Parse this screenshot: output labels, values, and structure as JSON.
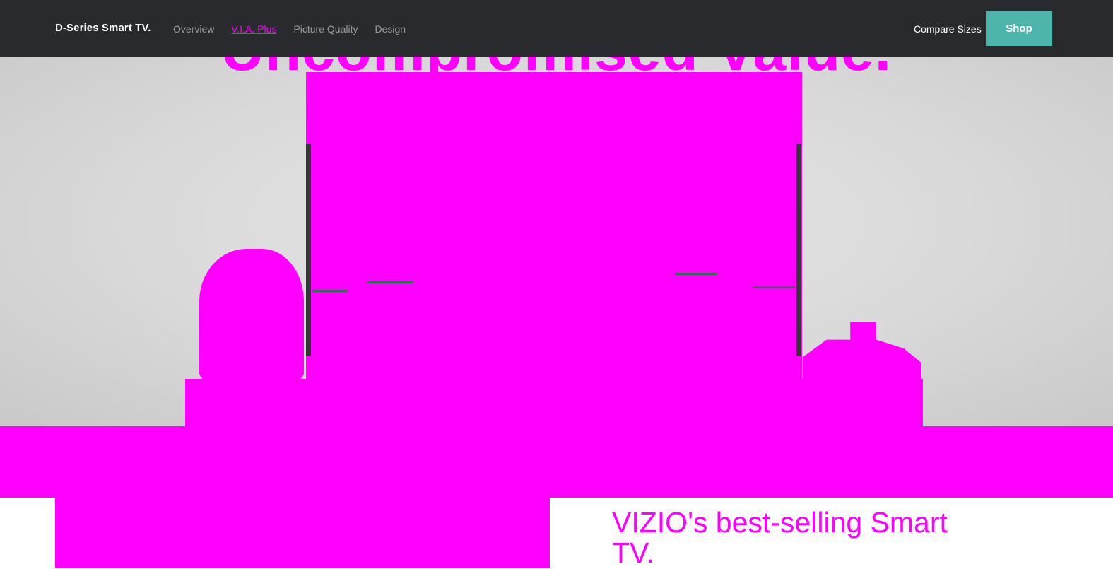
{
  "nav": {
    "brand": "D-Series Smart TV.",
    "links": [
      {
        "label": "Overview",
        "active": false
      },
      {
        "label": "V.I.A. Plus",
        "active": true
      },
      {
        "label": "Picture Quality",
        "active": false
      },
      {
        "label": "Design",
        "active": false
      }
    ],
    "compare_label": "Compare Sizes",
    "shop_label": "Shop"
  },
  "hero": {
    "headline": "Uncompromised Value."
  },
  "feature": {
    "title": "VIZIO's best-selling Smart TV."
  },
  "colors": {
    "nav_bg": "#282a2e",
    "accent": "#ff00ff",
    "shop_button": "#4eb5ad"
  }
}
